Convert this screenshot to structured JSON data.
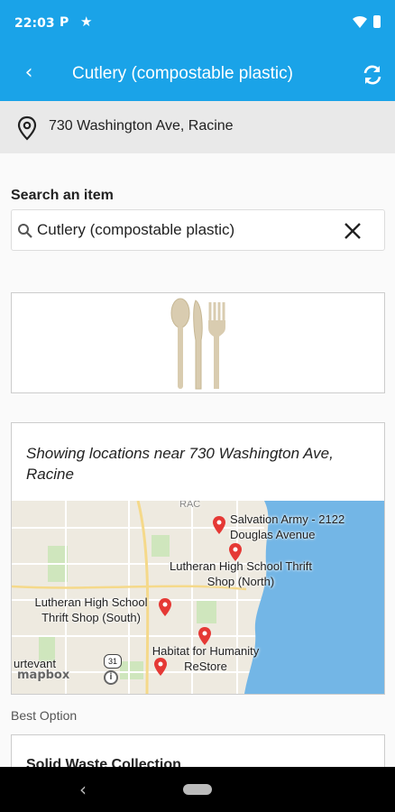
{
  "status_bar": {
    "time": "22:03",
    "p_glyph": "P"
  },
  "app_bar": {
    "title": "Cutlery (compostable plastic)"
  },
  "location": {
    "address": "730 Washington Ave, Racine"
  },
  "search": {
    "label": "Search an item",
    "value": "Cutlery (compostable plastic)"
  },
  "map": {
    "caption": "Showing locations near 730 Washington Ave, Racine",
    "labels": [
      "Salvation Army - 2122 Douglas Avenue",
      "Lutheran High School Thrift Shop (North)",
      "Lutheran High School Thrift Shop (South)",
      "Habitat for Humanity ReStore"
    ],
    "attribution": "mapbox",
    "road_label_top": "RAC",
    "road_label_town": "urtevant",
    "route_shield": "31",
    "water_color": "#73b6e6",
    "land_color": "#eeeae0",
    "park_color": "#cfe6bd"
  },
  "results": {
    "section_label": "Best Option",
    "first_title": "Solid Waste Collection"
  },
  "icons": [
    "back-arrow-icon",
    "refresh-icon",
    "location-pin-icon",
    "search-icon",
    "close-icon",
    "map-marker-icon",
    "wifi-icon",
    "battery-icon",
    "star-icon"
  ],
  "colors": {
    "primary": "#1aa3e8",
    "marker": "#e53935"
  }
}
